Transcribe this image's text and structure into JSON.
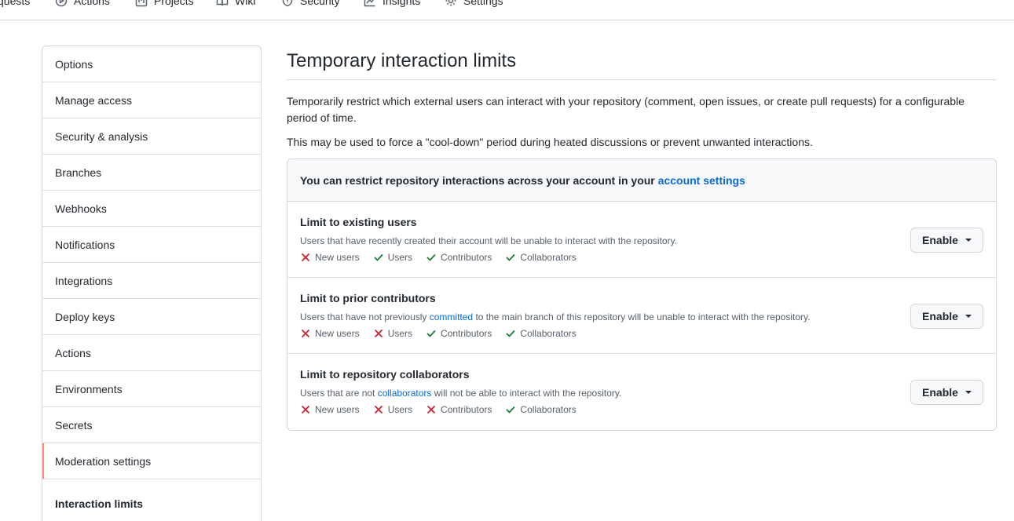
{
  "topnav": {
    "tabs": [
      {
        "label": "quests"
      },
      {
        "label": "Actions"
      },
      {
        "label": "Projects"
      },
      {
        "label": "Wiki"
      },
      {
        "label": "Security"
      },
      {
        "label": "Insights"
      },
      {
        "label": "Settings"
      }
    ]
  },
  "sidebar": {
    "items": [
      {
        "label": "Options"
      },
      {
        "label": "Manage access"
      },
      {
        "label": "Security & analysis"
      },
      {
        "label": "Branches"
      },
      {
        "label": "Webhooks"
      },
      {
        "label": "Notifications"
      },
      {
        "label": "Integrations"
      },
      {
        "label": "Deploy keys"
      },
      {
        "label": "Actions"
      },
      {
        "label": "Environments"
      },
      {
        "label": "Secrets"
      },
      {
        "label": "Moderation settings"
      }
    ],
    "sub_item": "Interaction limits"
  },
  "main": {
    "title": "Temporary interaction limits",
    "description1": "Temporarily restrict which external users can interact with your repository (comment, open issues, or create pull requests) for a configurable period of time.",
    "description2": "This may be used to force a \"cool-down\" period during heated discussions or prevent unwanted interactions.",
    "box_header": {
      "text": "You can restrict repository interactions across your account in your ",
      "link": "account settings"
    },
    "limits": [
      {
        "title": "Limit to existing users",
        "desc_before": "Users that have recently created their account will be unable to interact with the repository.",
        "desc_link": "",
        "desc_after": "",
        "button": "Enable",
        "perms": [
          {
            "label": "New users",
            "allowed": false
          },
          {
            "label": "Users",
            "allowed": true
          },
          {
            "label": "Contributors",
            "allowed": true
          },
          {
            "label": "Collaborators",
            "allowed": true
          }
        ]
      },
      {
        "title": "Limit to prior contributors",
        "desc_before": "Users that have not previously ",
        "desc_link": "committed",
        "desc_after": " to the main branch of this repository will be unable to interact with the repository.",
        "button": "Enable",
        "perms": [
          {
            "label": "New users",
            "allowed": false
          },
          {
            "label": "Users",
            "allowed": false
          },
          {
            "label": "Contributors",
            "allowed": true
          },
          {
            "label": "Collaborators",
            "allowed": true
          }
        ]
      },
      {
        "title": "Limit to repository collaborators",
        "desc_before": "Users that are not ",
        "desc_link": "collaborators",
        "desc_after": " will not be able to interact with the repository.",
        "button": "Enable",
        "perms": [
          {
            "label": "New users",
            "allowed": false
          },
          {
            "label": "Users",
            "allowed": false
          },
          {
            "label": "Contributors",
            "allowed": false
          },
          {
            "label": "Collaborators",
            "allowed": true
          }
        ]
      }
    ]
  },
  "colors": {
    "accent_link": "#0969da",
    "selected_bar": "#fd8c73",
    "deny": "#cf222e",
    "allow": "#1a7f37"
  }
}
